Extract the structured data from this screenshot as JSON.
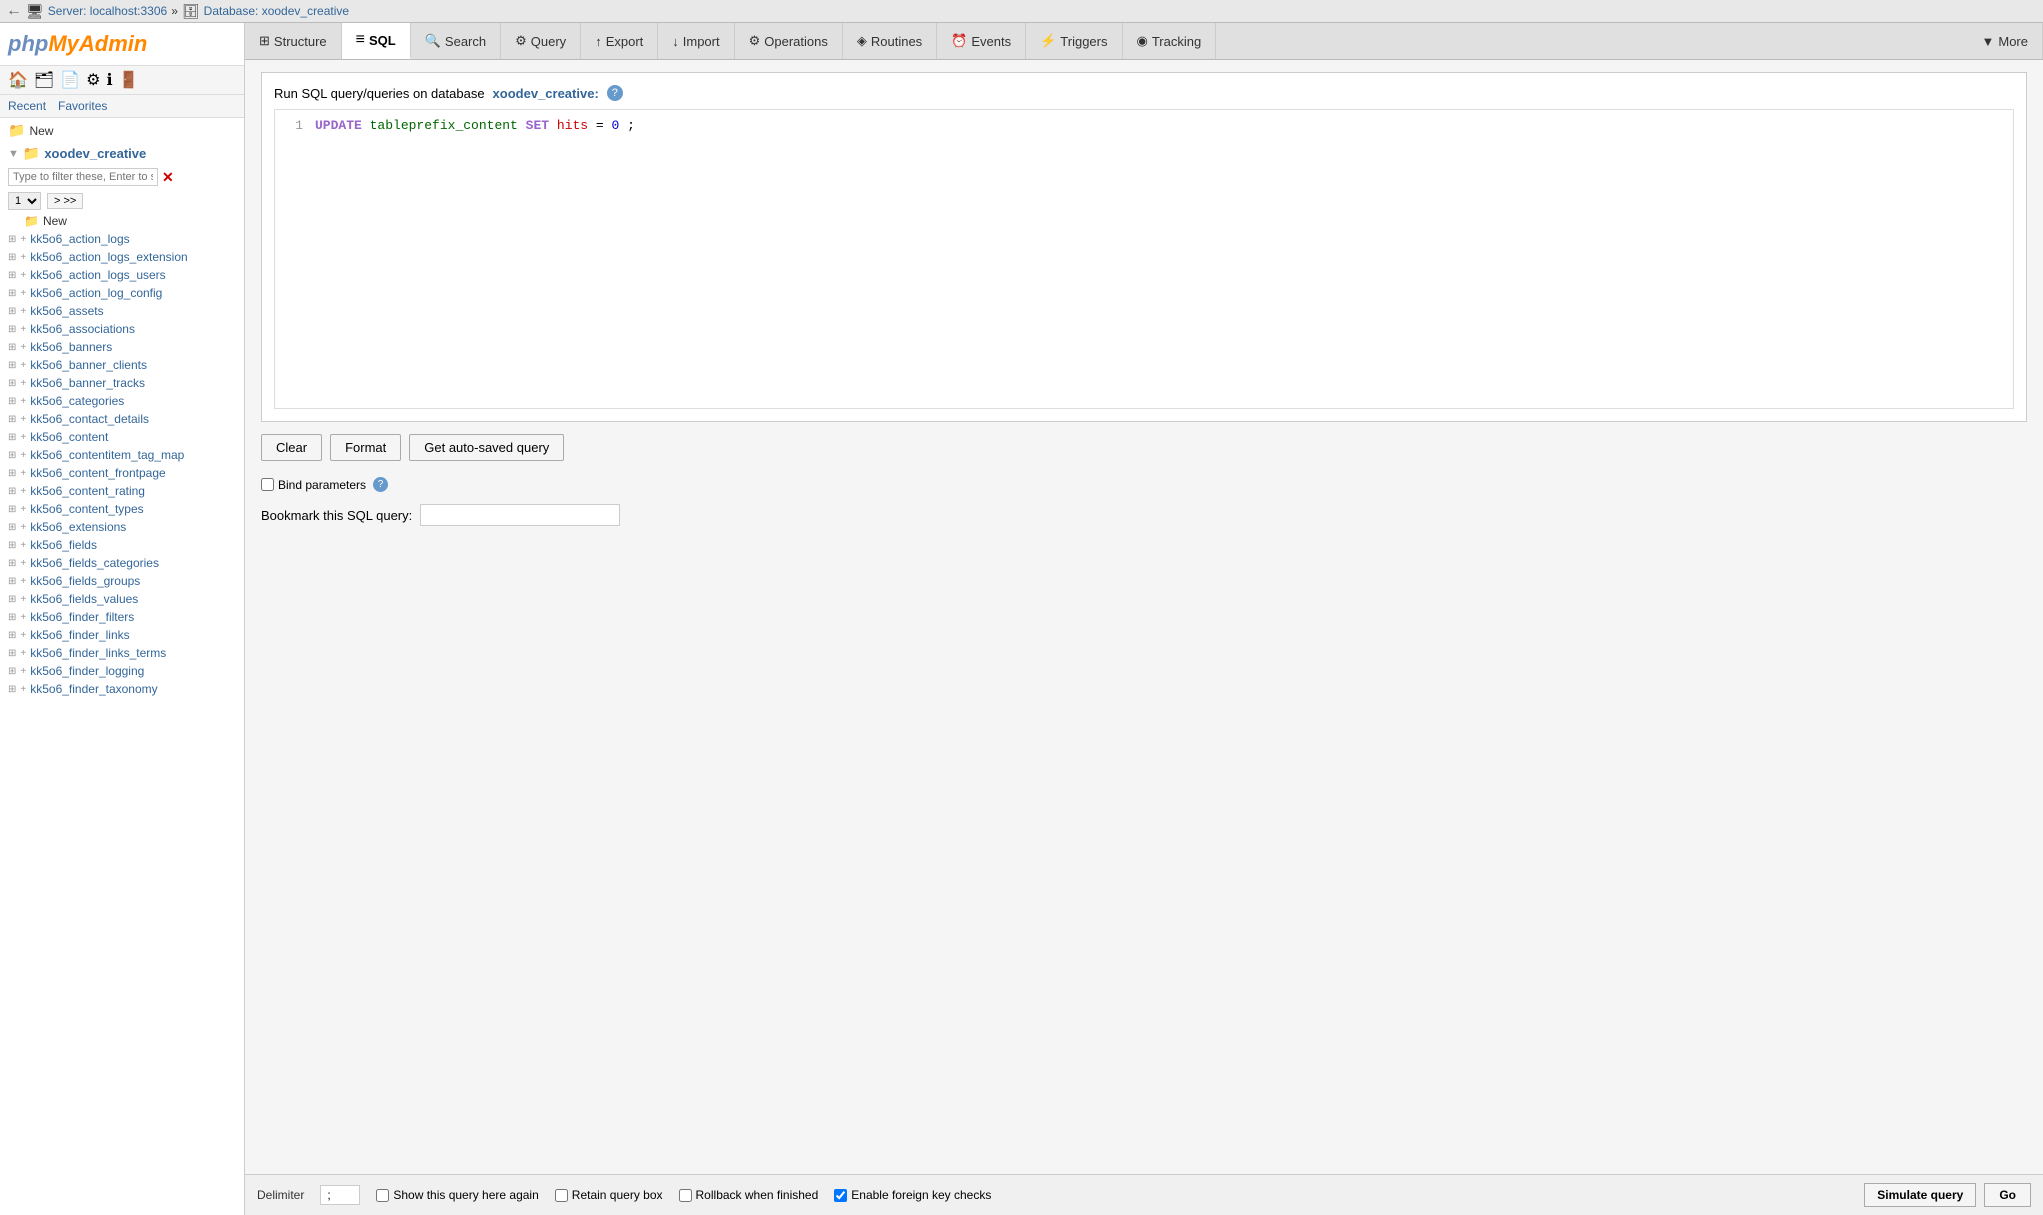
{
  "topbar": {
    "server": "Server: localhost:3306",
    "separator": "»",
    "database": "Database: xoodev_creative",
    "server_icon": "🖥",
    "db_icon": "🗄"
  },
  "tabs": [
    {
      "id": "structure",
      "label": "Structure",
      "icon": "⊞",
      "active": false
    },
    {
      "id": "sql",
      "label": "SQL",
      "icon": "≡",
      "active": true
    },
    {
      "id": "search",
      "label": "Search",
      "icon": "🔍",
      "active": false
    },
    {
      "id": "query",
      "label": "Query",
      "icon": "⚙",
      "active": false
    },
    {
      "id": "export",
      "label": "Export",
      "icon": "↑",
      "active": false
    },
    {
      "id": "import",
      "label": "Import",
      "icon": "↓",
      "active": false
    },
    {
      "id": "operations",
      "label": "Operations",
      "icon": "⚙",
      "active": false
    },
    {
      "id": "routines",
      "label": "Routines",
      "icon": "◈",
      "active": false
    },
    {
      "id": "events",
      "label": "Events",
      "icon": "⏰",
      "active": false
    },
    {
      "id": "triggers",
      "label": "Triggers",
      "icon": "⚡",
      "active": false
    },
    {
      "id": "tracking",
      "label": "Tracking",
      "icon": "◉",
      "active": false
    },
    {
      "id": "more",
      "label": "More",
      "icon": "▼",
      "active": false
    }
  ],
  "logo": {
    "php": "php",
    "my": "My",
    "admin": "Admin"
  },
  "sidebar": {
    "recent_label": "Recent",
    "favorites_label": "Favorites",
    "new_label": "New",
    "db_name": "xoodev_creative",
    "filter_placeholder": "Type to filter these, Enter to se",
    "page_select": "1",
    "nav_forward": "> >>",
    "new_table_label": "New",
    "tables": [
      "kk5o6_action_logs",
      "kk5o6_action_logs_extension",
      "kk5o6_action_logs_users",
      "kk5o6_action_log_config",
      "kk5o6_assets",
      "kk5o6_associations",
      "kk5o6_banners",
      "kk5o6_banner_clients",
      "kk5o6_banner_tracks",
      "kk5o6_categories",
      "kk5o6_contact_details",
      "kk5o6_content",
      "kk5o6_contentitem_tag_map",
      "kk5o6_content_frontpage",
      "kk5o6_content_rating",
      "kk5o6_content_types",
      "kk5o6_extensions",
      "kk5o6_fields",
      "kk5o6_fields_categories",
      "kk5o6_fields_groups",
      "kk5o6_fields_values",
      "kk5o6_finder_filters",
      "kk5o6_finder_links",
      "kk5o6_finder_links_terms",
      "kk5o6_finder_logging",
      "kk5o6_finder_taxonomy"
    ]
  },
  "query_panel": {
    "header_text": "Run SQL query/queries on database",
    "db_link_text": "xoodev_creative:",
    "sql_code": "UPDATE tableprefix_content SET hits = 0;",
    "line_number": "1",
    "clear_label": "Clear",
    "format_label": "Format",
    "autosave_label": "Get auto-saved query",
    "bind_params_label": "Bind parameters",
    "bookmark_label": "Bookmark this SQL query:",
    "bookmark_placeholder": ""
  },
  "bottom_bar": {
    "delimiter_label": "Delimiter",
    "delimiter_value": ";",
    "show_query_label": "Show this query here again",
    "retain_query_label": "Retain query box",
    "rollback_label": "Rollback when finished",
    "foreign_key_label": "Enable foreign key checks",
    "simulate_label": "Simulate query",
    "go_label": "Go",
    "foreign_key_checked": true,
    "rollback_checked": false,
    "show_query_checked": false,
    "retain_query_checked": false
  }
}
